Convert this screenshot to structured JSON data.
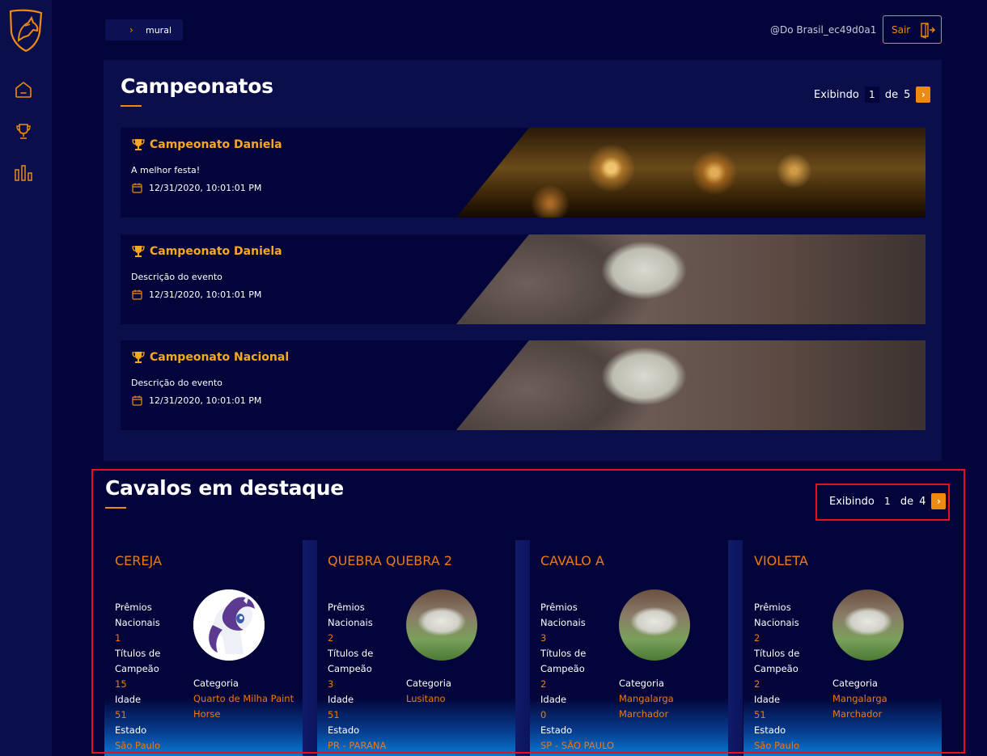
{
  "sidebar": {
    "items": [
      {
        "icon": "home-icon"
      },
      {
        "icon": "trophy-icon"
      },
      {
        "icon": "bar-chart-icon"
      }
    ]
  },
  "breadcrumb": {
    "label": "mural"
  },
  "header": {
    "username": "@Do Brasil_ec49d0a1",
    "logout_label": "Sair"
  },
  "colors": {
    "accent": "#ee8a10",
    "background": "#03053a",
    "panel": "#0a0e4a",
    "gold": "#f7a821",
    "highlight": "#e8101e"
  },
  "championships": {
    "title": "Campeonatos",
    "pager": {
      "showing_label": "Exibindo",
      "current": "1",
      "of_label": "de",
      "total": "5",
      "next": "›"
    },
    "items": [
      {
        "name": "Campeonato Daniela",
        "description": "A melhor festa!",
        "date": "12/31/2020, 10:01:01 PM"
      },
      {
        "name": "Campeonato Daniela",
        "description": "Descrição do evento",
        "date": "12/31/2020, 10:01:01 PM"
      },
      {
        "name": "Campeonato Nacional",
        "description": "Descrição do evento",
        "date": "12/31/2020, 10:01:01 PM"
      }
    ]
  },
  "horses": {
    "title": "Cavalos em destaque",
    "pager": {
      "showing_label": "Exibindo",
      "current": "1",
      "of_label": "de",
      "total": "4",
      "next": "›"
    },
    "labels": {
      "awards": "Prêmios",
      "national": "Nacionais",
      "titles": "Títulos de",
      "champion": "Campeão",
      "age": "Idade",
      "state": "Estado",
      "category": "Categoria"
    },
    "items": [
      {
        "name": "CEREJA",
        "awards": "1",
        "titles": "15",
        "age": "51",
        "state": "São Paulo",
        "category": "Quarto de Milha Paint Horse"
      },
      {
        "name": "QUEBRA QUEBRA 2",
        "awards": "2",
        "titles": "3",
        "age": "51",
        "state": "PR - PARANA",
        "category": "Lusitano"
      },
      {
        "name": "CAVALO A",
        "awards": "3",
        "titles": "2",
        "age": "0",
        "state": "SP - SÃO PAULO",
        "category": "Mangalarga Marchador"
      },
      {
        "name": "VIOLETA",
        "awards": "2",
        "titles": "2",
        "age": "51",
        "state": "São Paulo",
        "category": "Mangalarga Marchador"
      }
    ]
  }
}
